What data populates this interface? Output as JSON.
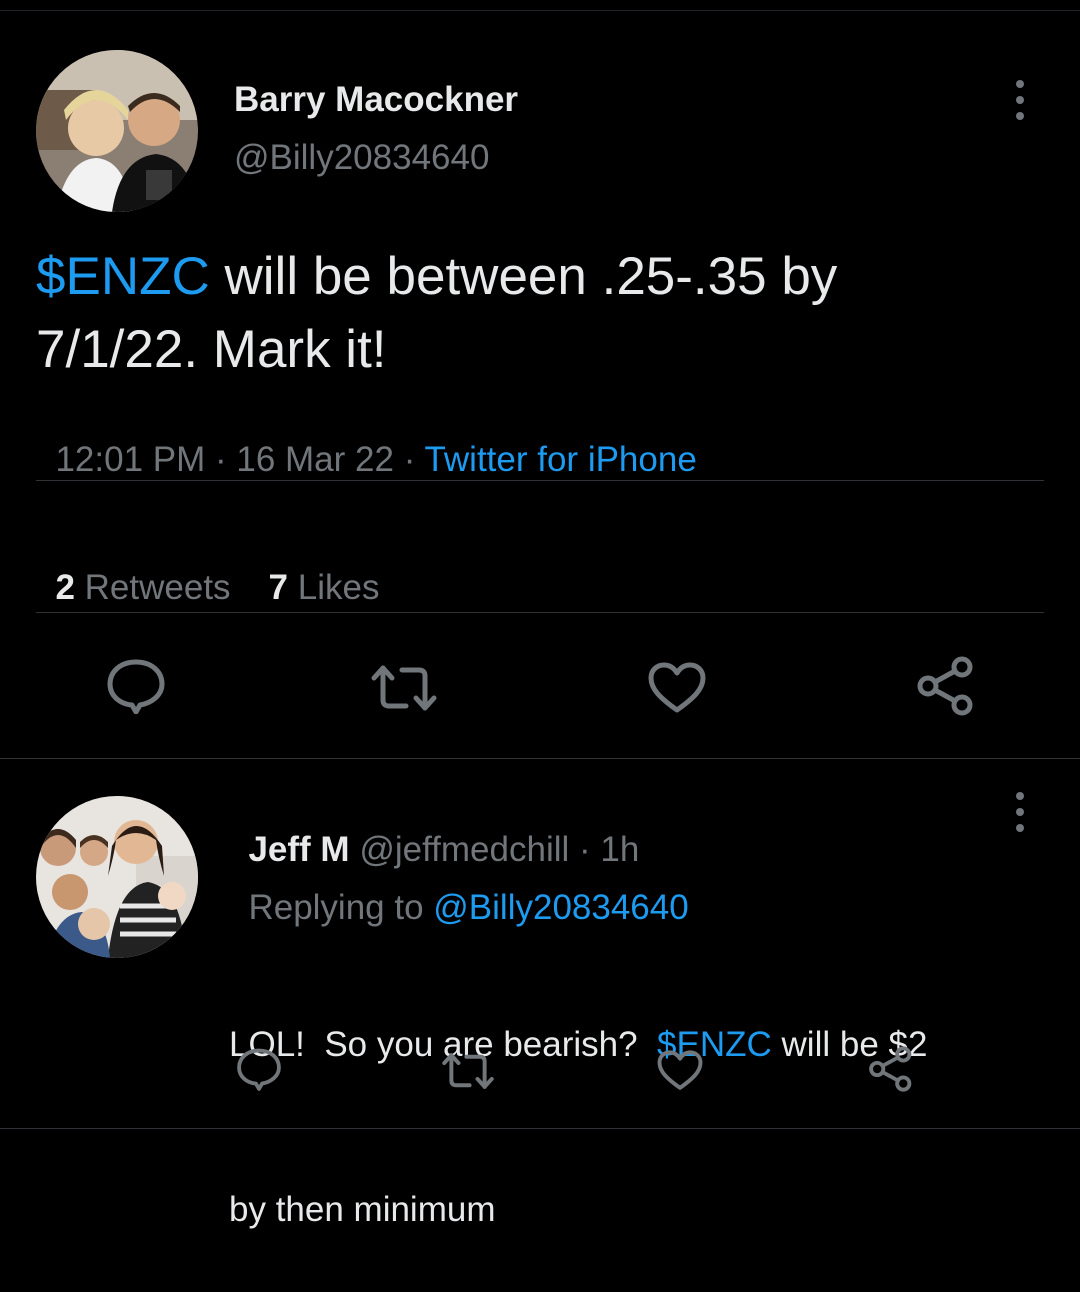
{
  "main_tweet": {
    "author_name": "Barry Macockner",
    "author_handle": "@Billy20834640",
    "text_cashtag": "$ENZC",
    "text_line1_rest": " will be between .25-.35 by",
    "text_line2": "7/1/22. Mark it!",
    "time": "12:01 PM",
    "dot": " · ",
    "date": "16 Mar 22",
    "source": "Twitter for iPhone",
    "retweets_count": "2",
    "retweets_label": " Retweets",
    "likes_count": "7",
    "likes_label": " Likes"
  },
  "reply": {
    "author_name": "Jeff M",
    "author_handle": "@jeffmedchill",
    "time": " · 1h",
    "replying_label": "Replying to ",
    "replying_handle": "@Billy20834640",
    "text_part1": "LOL!  So you are bearish?  ",
    "text_cashtag": "$ENZC",
    "text_part2": " will be $2",
    "text_line2": "by then minimum"
  },
  "colors": {
    "background": "#000000",
    "text": "#e7e9ea",
    "muted": "#71767b",
    "link": "#1d9bf0",
    "separator": "#2f3336"
  },
  "icons": [
    "more-icon",
    "reply-icon",
    "retweet-icon",
    "like-icon",
    "share-icon"
  ]
}
